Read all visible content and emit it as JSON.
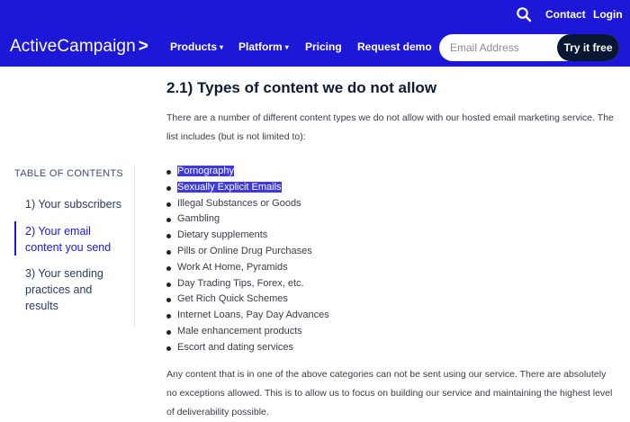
{
  "topbar": {
    "contact": "Contact",
    "login": "Login"
  },
  "nav": {
    "logo": "ActiveCampaign",
    "logo_arrow": ">",
    "items": [
      {
        "label": "Products",
        "caret": "▾"
      },
      {
        "label": "Platform",
        "caret": "▾"
      },
      {
        "label": "Pricing"
      },
      {
        "label": "Request demo"
      }
    ],
    "email_placeholder": "Email Address",
    "cta": "Try it free"
  },
  "toc": {
    "title": "TABLE OF CONTENTS",
    "items": [
      {
        "label": "1) Your subscribers",
        "active": false
      },
      {
        "label": "2) Your email content you send",
        "active": true
      },
      {
        "label": "3) Your sending practices and results",
        "active": false
      }
    ]
  },
  "content": {
    "heading": "2.1) Types of content we do not allow",
    "intro": "There are a number of different content types we do not allow with our hosted email marketing service. The list includes (but is not limited to):",
    "list": [
      {
        "text": "Pornography",
        "selected": true
      },
      {
        "text": "Sexually Explicit Emails",
        "selected": true
      },
      {
        "text": "Illegal Substances or Goods",
        "selected": false
      },
      {
        "text": "Gambling",
        "selected": false
      },
      {
        "text": "Dietary supplements",
        "selected": false
      },
      {
        "text": "Pills or Online Drug Purchases",
        "selected": false
      },
      {
        "text": "Work At Home, Pyramids",
        "selected": false
      },
      {
        "text": "Day Trading Tips, Forex, etc.",
        "selected": false
      },
      {
        "text": "Get Rich Quick Schemes",
        "selected": false
      },
      {
        "text": "Internet Loans, Pay Day Advances",
        "selected": false
      },
      {
        "text": "Male enhancement products",
        "selected": false
      },
      {
        "text": "Escort and dating services",
        "selected": false
      }
    ],
    "outro": "Any content that is in one of the above categories can not be sent using our service. There are absolutely no exceptions allowed. This is to allow us to focus on building our service and maintaining the highest level of deliverability possible."
  },
  "colors": {
    "brand": "#1d17d8",
    "cta_bg": "#0a1733",
    "selection": "#3f39d6"
  },
  "icons": {
    "search": "search-icon"
  }
}
